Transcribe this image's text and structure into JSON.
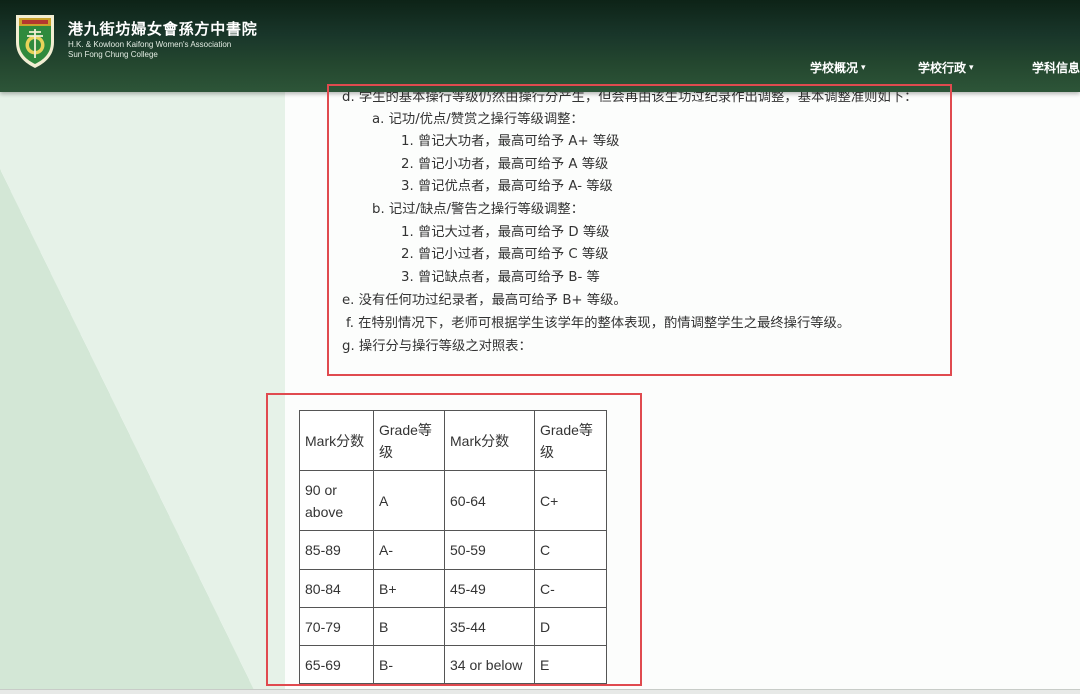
{
  "header": {
    "school_name_zh": "港九街坊婦女會孫方中書院",
    "school_name_en_line1": "H.K. & Kowloon Kaifong Women's Association",
    "school_name_en_line2": "Sun Fong Chung College",
    "logo_icon": "school-crest-icon",
    "nav": [
      {
        "label": "学校概况",
        "icon": "caret-down-icon"
      },
      {
        "label": "学校行政",
        "icon": "caret-down-icon"
      },
      {
        "label": "学科信息"
      }
    ]
  },
  "rules": {
    "d": "d. 学生的基本操行等级仍然由操行分产生，但会再由该生功过纪录作出调整，基本调整准则如下：",
    "a_heading": "a. 记功/优点/赞赏之操行等级调整：",
    "a_items": [
      "1. 曾记大功者，最高可给予 A+ 等级",
      "2. 曾记小功者，最高可给予 A 等级",
      "3. 曾记优点者，最高可给予 A- 等级"
    ],
    "b_heading": "b. 记过/缺点/警告之操行等级调整：",
    "b_items": [
      "1. 曾记大过者，最高可给予 D 等级",
      "2. 曾记小过者，最高可给予 C 等级",
      "3. 曾记缺点者，最高可给予 B- 等"
    ],
    "e": "e. 没有任何功过纪录者，最高可给予 B+ 等级。",
    "f": "f. 在特别情况下，老师可根据学生该学年的整体表现，酌情调整学生之最终操行等级。",
    "g": "g. 操行分与操行等级之对照表："
  },
  "conduct_table": {
    "headers": [
      "Mark分数",
      "Grade等级",
      "Mark分数",
      "Grade等级"
    ],
    "rows": [
      [
        "90 or above",
        "A",
        "60-64",
        "C+"
      ],
      [
        "85-89",
        "A-",
        "50-59",
        "C"
      ],
      [
        "80-84",
        "B+",
        "45-49",
        "C-"
      ],
      [
        "70-79",
        "B",
        "35-44",
        "D"
      ],
      [
        "65-69",
        "B-",
        "34 or below",
        "E"
      ]
    ]
  },
  "colors": {
    "header_dark": "#0d2317",
    "header_light": "#2d5538",
    "side_panel_green": "#d3e7d6",
    "annotation_red": "#e04a4f",
    "text": "#333333"
  }
}
